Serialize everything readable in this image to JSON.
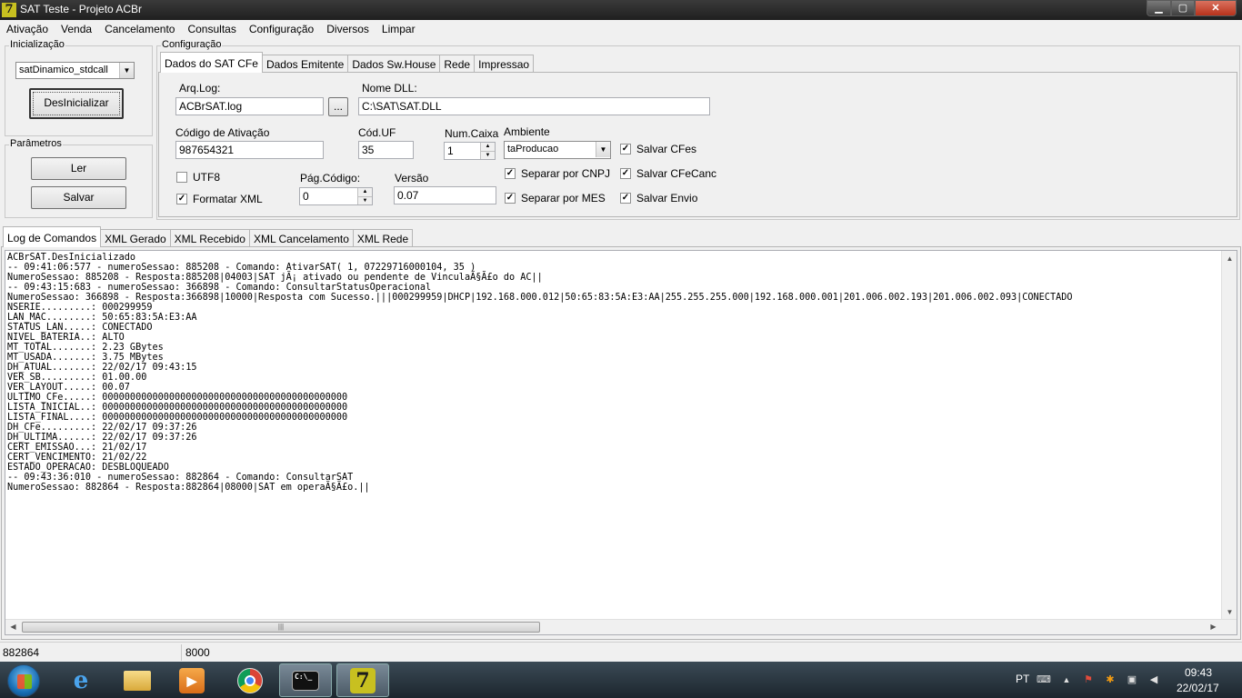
{
  "window": {
    "title": "SAT Teste - Projeto ACBr",
    "app_icon": "7"
  },
  "window_controls": {
    "minimize": "▁",
    "maximize": "▢",
    "close": "✕"
  },
  "menu": [
    "Ativação",
    "Venda",
    "Cancelamento",
    "Consultas",
    "Configuração",
    "Diversos",
    "Limpar"
  ],
  "init": {
    "legend": "Inicialização",
    "model_value": "satDinamico_stdcall",
    "deinit_button": "DesInicializar"
  },
  "params": {
    "legend": "Parâmetros",
    "read_button": "Ler",
    "save_button": "Salvar"
  },
  "config": {
    "legend": "Configuração",
    "tabs": [
      "Dados do SAT CFe",
      "Dados Emitente",
      "Dados Sw.House",
      "Rede",
      "Impressao"
    ],
    "active_tab": 0,
    "arq_log_label": "Arq.Log:",
    "arq_log_value": "ACBrSAT.log",
    "browse_button": "...",
    "nome_dll_label": "Nome DLL:",
    "nome_dll_value": "C:\\SAT\\SAT.DLL",
    "codigo_ativacao_label": "Código de Ativação",
    "codigo_ativacao_value": "987654321",
    "cod_uf_label": "Cód.UF",
    "cod_uf_value": "35",
    "num_caixa_label": "Num.Caixa",
    "num_caixa_value": "1",
    "ambiente_label": "Ambiente",
    "ambiente_value": "taProducao",
    "utf8_label": "UTF8",
    "utf8_checked": false,
    "formatar_xml_label": "Formatar XML",
    "formatar_xml_checked": true,
    "pag_codigo_label": "Pág.Código:",
    "pag_codigo_value": "0",
    "versao_label": "Versão",
    "versao_value": "0.07",
    "separar_cnpj_label": "Separar por CNPJ",
    "separar_mes_label": "Separar por MES",
    "salvar_cfes_label": "Salvar CFes",
    "salvar_cfecanc_label": "Salvar CFeCanc",
    "salvar_envio_label": "Salvar Envio",
    "check_mark": "✓"
  },
  "log_tabs": [
    "Log de Comandos",
    "XML Gerado",
    "XML Recebido",
    "XML Cancelamento",
    "XML Rede"
  ],
  "log_lines": [
    "ACBrSAT.DesInicializado",
    "-- 09:41:06:577 - numeroSessao: 885208 - Comando: AtivarSAT( 1, 07229716000104, 35 )",
    "NumeroSessao: 885208 - Resposta:885208|04003|SAT jÃ¡ ativado ou pendente de VinculaÃ§Ã£o do AC||",
    "-- 09:43:15:683 - numeroSessao: 366898 - Comando: ConsultarStatusOperacional",
    "NumeroSessao: 366898 - Resposta:366898|10000|Resposta com Sucesso.|||000299959|DHCP|192.168.000.012|50:65:83:5A:E3:AA|255.255.255.000|192.168.000.001|201.006.002.193|201.006.002.093|CONECTADO",
    "NSERIE.........: 000299959",
    "LAN_MAC........: 50:65:83:5A:E3:AA",
    "STATUS_LAN.....: CONECTADO",
    "NIVEL_BATERIA..: ALTO",
    "MT_TOTAL.......: 2.23 GBytes",
    "MT_USADA.......: 3.75 MBytes",
    "DH_ATUAL.......: 22/02/17 09:43:15",
    "VER_SB.........: 01.00.00",
    "VER_LAYOUT.....: 00.07",
    "ULTIMO_CFe.....: 00000000000000000000000000000000000000000000",
    "LISTA_INICIAL..: 00000000000000000000000000000000000000000000",
    "LISTA_FINAL....: 00000000000000000000000000000000000000000000",
    "DH_CFe.........: 22/02/17 09:37:26",
    "DH_ULTIMA......: 22/02/17 09:37:26",
    "CERT_EMISSAO...: 21/02/17",
    "CERT_VENCIMENTO: 21/02/22",
    "ESTADO_OPERACAO: DESBLOQUEADO",
    "-- 09:43:36:010 - numeroSessao: 882864 - Comando: ConsultarSAT",
    "NumeroSessao: 882864 - Resposta:882864|08000|SAT em operaÃ§Ã£o.||"
  ],
  "scroll": {
    "up": "▲",
    "down": "▼",
    "left": "◀",
    "right": "▶",
    "grip": "|||"
  },
  "status": {
    "panel1": "882864",
    "panel2": "8000"
  },
  "taskbar": {
    "language": "PT",
    "time": "09:43",
    "date": "22/02/17",
    "cmd_label": "C:\\_",
    "app_label": "7"
  }
}
